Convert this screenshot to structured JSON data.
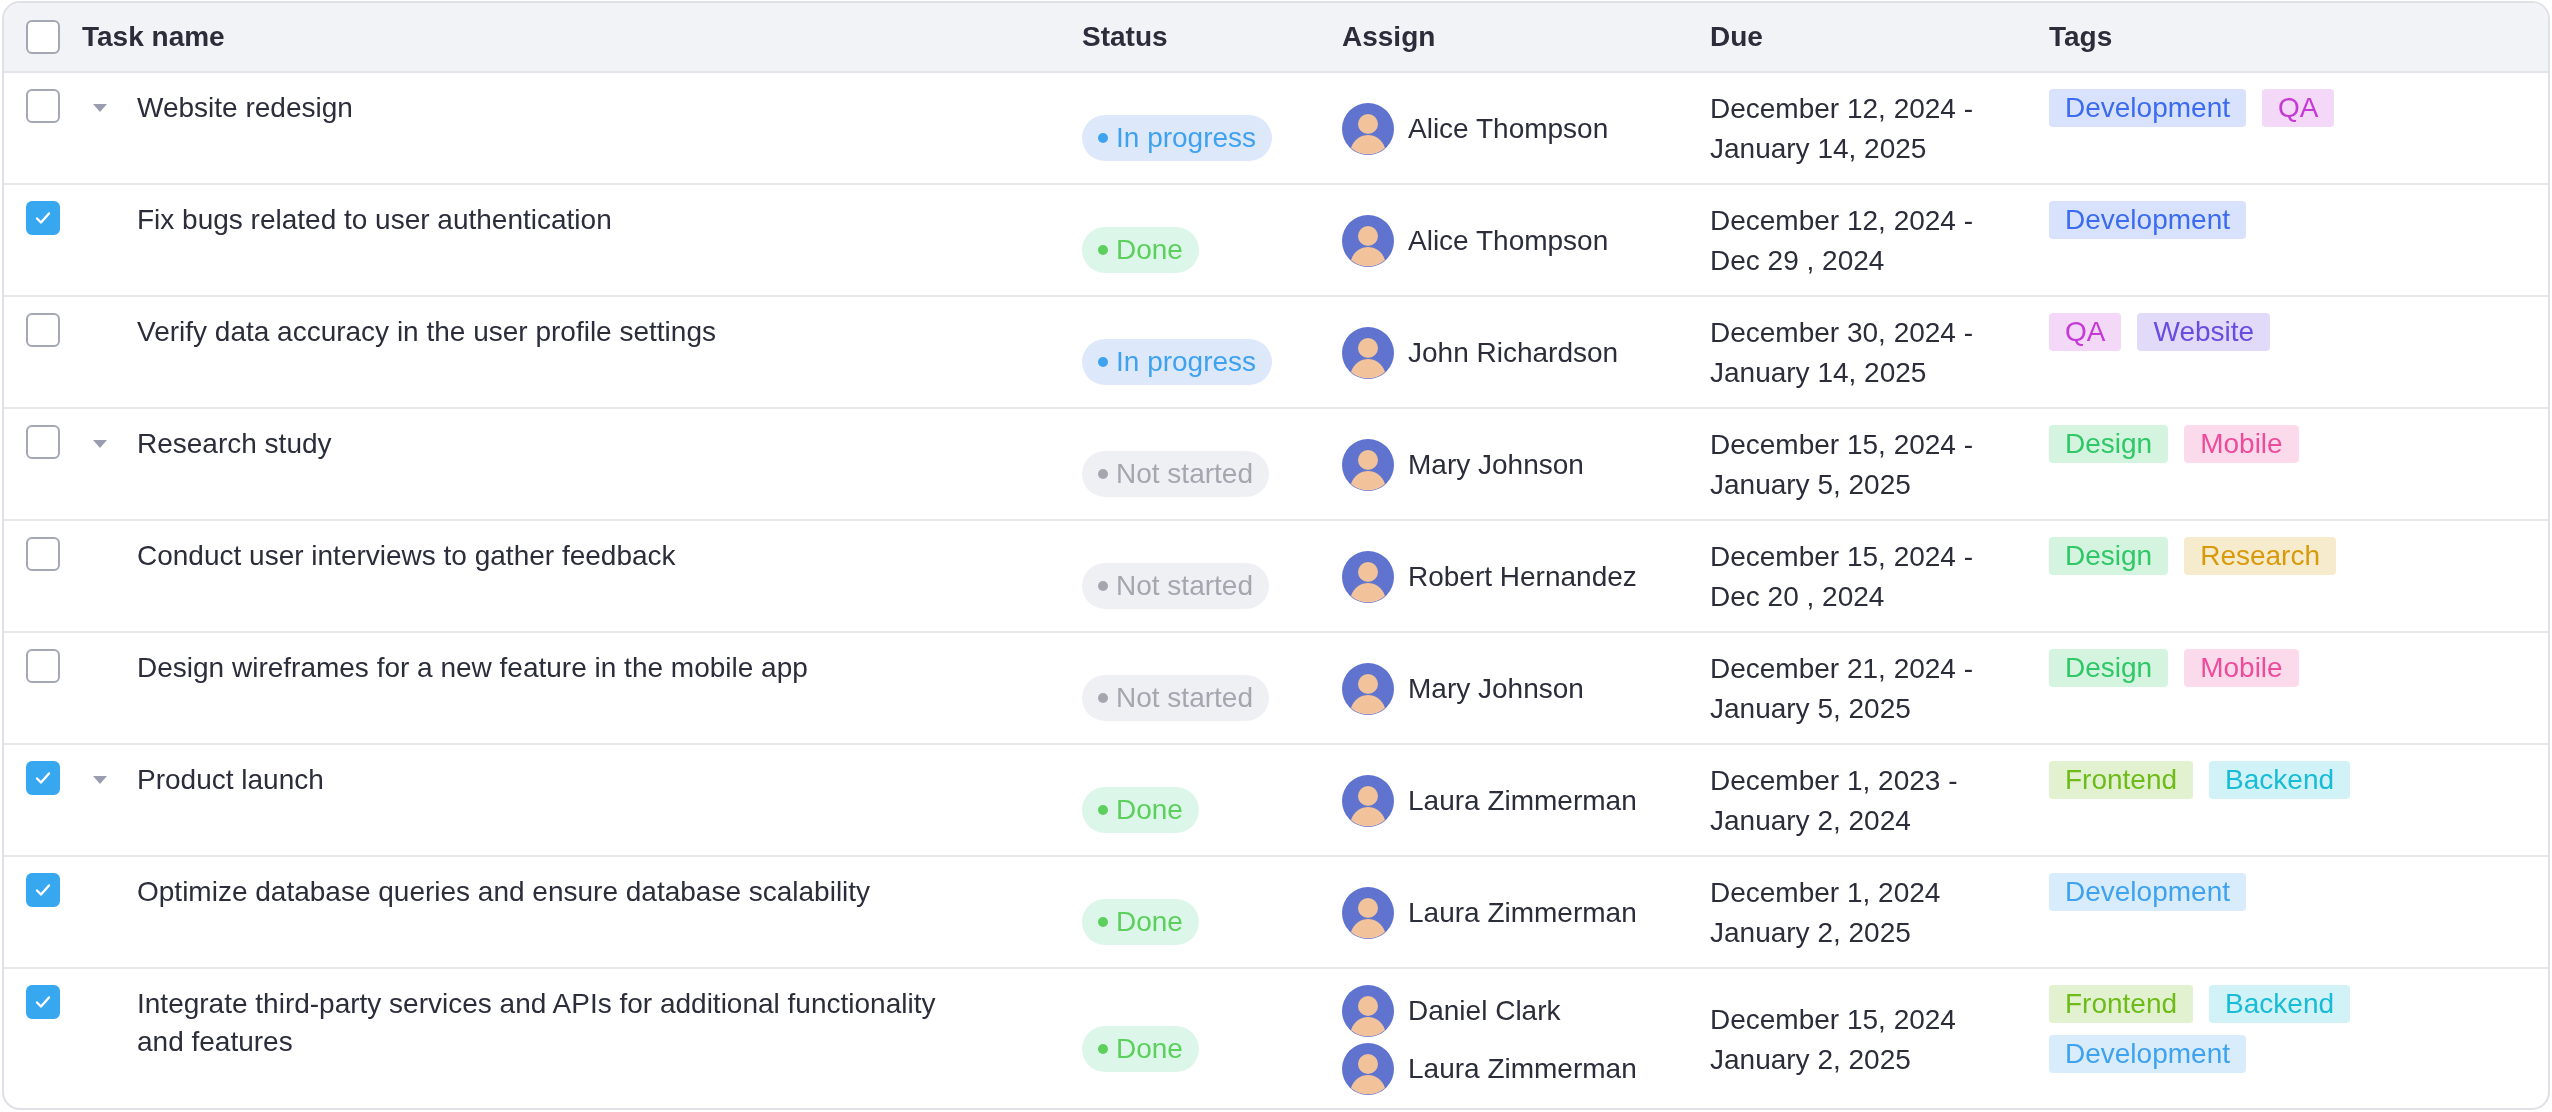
{
  "table": {
    "select_all_checked": false,
    "columns": [
      "Task name",
      "Status",
      "Assign",
      "Due",
      "Tags"
    ],
    "rows": [
      {
        "checked": false,
        "expanded": true,
        "name": "Website redesign",
        "status": {
          "kind": "in_progress",
          "label": "In progress"
        },
        "assignees": [
          "Alice Thompson"
        ],
        "due": [
          "December 12, 2024 -",
          "January 14, 2025"
        ],
        "tags": [
          {
            "label": "Development",
            "color": "#3b6cf0"
          },
          {
            "label": "QA",
            "color": "#c53ad6"
          }
        ],
        "children": [
          {
            "checked": true,
            "name": "Fix bugs related to user authentication",
            "status": {
              "kind": "done",
              "label": "Done"
            },
            "assignees": [
              "Alice Thompson"
            ],
            "due": [
              "December 12, 2024 -",
              "Dec 29 , 2024"
            ],
            "tags": [
              {
                "label": "Development",
                "color": "#3b6cf0"
              }
            ]
          },
          {
            "checked": false,
            "name": "Verify data accuracy in the user profile settings",
            "status": {
              "kind": "in_progress",
              "label": "In progress"
            },
            "assignees": [
              "John Richardson"
            ],
            "due": [
              "December 30, 2024 -",
              "January 14, 2025"
            ],
            "tags": [
              {
                "label": "QA",
                "color": "#c53ad6"
              },
              {
                "label": "Website",
                "color": "#6a4ce0"
              }
            ]
          }
        ]
      },
      {
        "checked": false,
        "expanded": true,
        "name": "Research study",
        "status": {
          "kind": "not_started",
          "label": "Not started"
        },
        "assignees": [
          "Mary Johnson"
        ],
        "due": [
          "December 15, 2024 -",
          "January 5, 2025"
        ],
        "tags": [
          {
            "label": "Design",
            "color": "#2ec866"
          },
          {
            "label": "Mobile",
            "color": "#ec4c9c"
          }
        ],
        "children": [
          {
            "checked": false,
            "name": "Conduct user interviews to gather feedback",
            "status": {
              "kind": "not_started",
              "label": "Not started"
            },
            "assignees": [
              "Robert Hernandez"
            ],
            "due": [
              "December 15, 2024 -",
              "Dec 20 , 2024"
            ],
            "tags": [
              {
                "label": "Design",
                "color": "#2ec866"
              },
              {
                "label": "Research",
                "color": "#d99a0a"
              }
            ]
          },
          {
            "checked": false,
            "name": "Design wireframes for a new feature in the mobile app",
            "status": {
              "kind": "not_started",
              "label": "Not started"
            },
            "assignees": [
              "Mary Johnson"
            ],
            "due": [
              "December 21, 2024 -",
              "January 5, 2025"
            ],
            "tags": [
              {
                "label": "Design",
                "color": "#2ec866"
              },
              {
                "label": "Mobile",
                "color": "#ec4c9c"
              }
            ]
          }
        ]
      },
      {
        "checked": true,
        "expanded": true,
        "name": "Product launch",
        "status": {
          "kind": "done",
          "label": "Done"
        },
        "assignees": [
          "Laura Zimmerman"
        ],
        "due": [
          "December 1, 2023 -",
          "January 2, 2024"
        ],
        "tags": [
          {
            "label": "Frontend",
            "color": "#6ebc1a"
          },
          {
            "label": "Backend",
            "color": "#18bcd6"
          }
        ],
        "children": [
          {
            "checked": true,
            "name": "Optimize database queries and ensure database scalability",
            "status": {
              "kind": "done",
              "label": "Done"
            },
            "assignees": [
              "Laura Zimmerman"
            ],
            "due": [
              "December 1, 2024",
              "January 2, 2025"
            ],
            "tags": [
              {
                "label": "Development",
                "color": "#3ea2ee"
              }
            ]
          },
          {
            "checked": true,
            "name": "Integrate third-party services and APIs for additional functionality and features",
            "status": {
              "kind": "done",
              "label": "Done"
            },
            "assignees": [
              "Daniel Clark",
              "Laura Zimmerman"
            ],
            "due": [
              "December 15, 2024",
              "January 2, 2025"
            ],
            "tags": [
              {
                "label": "Frontend",
                "color": "#6ebc1a"
              },
              {
                "label": "Backend",
                "color": "#18bcd6"
              },
              {
                "label": "Development",
                "color": "#3ea2ee"
              }
            ]
          }
        ]
      }
    ]
  }
}
